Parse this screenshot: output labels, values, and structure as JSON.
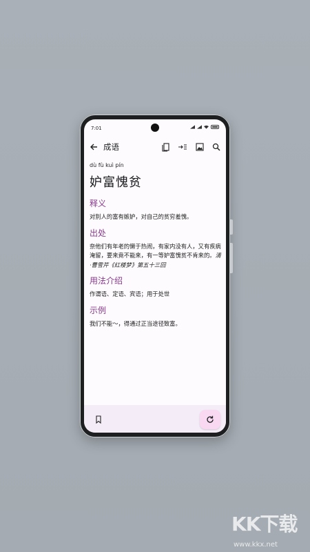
{
  "status_bar": {
    "time": "7:01"
  },
  "app_bar": {
    "title": "成语",
    "actions": [
      "bookmarks-icon",
      "import-icon",
      "image-icon",
      "search-icon"
    ]
  },
  "entry": {
    "pinyin": "dù fù kuì pín",
    "word": "妒富愧贫",
    "sections": [
      {
        "title": "释义",
        "text": "对别人的富有嫉妒，对自己的贫穷羞愧。"
      },
      {
        "title": "出处",
        "text": "奈他们有年老的懒于热闹，有家内没有人，又有疾病淹留，要来竟不能来，有一等妒富愧贫不肯来的。",
        "source": "清·曹雪芹《红楼梦》第五十三回"
      },
      {
        "title": "用法介绍",
        "text": "作谓语、定语、宾语；用于处世"
      },
      {
        "title": "示例",
        "text": "我们不能～，得通过正当途径致富。"
      }
    ]
  },
  "bottom_bar": {
    "left_icon": "bookmark-icon",
    "fab_icon": "refresh-icon"
  },
  "watermark": {
    "logo": "KK下载",
    "url": "www.kkx.net"
  },
  "colors": {
    "accent": "#8a3b8f",
    "fab": "#f9d8f2",
    "bottom_bar": "#f4ecf6"
  }
}
